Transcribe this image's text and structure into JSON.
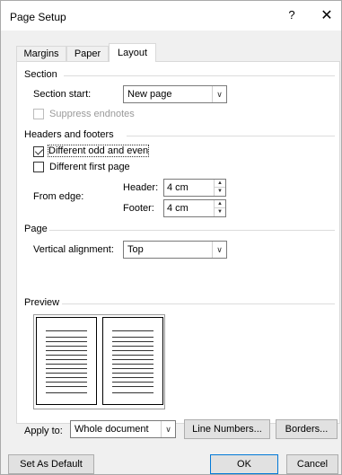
{
  "window": {
    "title": "Page Setup",
    "help_label": "?",
    "close_label": "✕"
  },
  "tabs": [
    {
      "label": "Margins"
    },
    {
      "label": "Paper"
    },
    {
      "label": "Layout",
      "active": true
    }
  ],
  "section": {
    "title": "Section",
    "start_label": "Section start:",
    "start_value": "New page",
    "suppress_label": "Suppress endnotes"
  },
  "headers_footers": {
    "title": "Headers and footers",
    "odd_even_label": "Different odd and even",
    "odd_even_checked": true,
    "first_page_label": "Different first page",
    "first_page_checked": false,
    "from_edge_label": "From edge:",
    "header_label": "Header:",
    "header_value": "4 cm",
    "footer_label": "Footer:",
    "footer_value": "4 cm"
  },
  "page": {
    "title": "Page",
    "valign_label": "Vertical alignment:",
    "valign_value": "Top"
  },
  "preview": {
    "title": "Preview"
  },
  "apply": {
    "label": "Apply to:",
    "value": "Whole document",
    "line_numbers_label": "Line Numbers...",
    "borders_label": "Borders..."
  },
  "footer_buttons": {
    "set_default_label": "Set As Default",
    "ok_label": "OK",
    "cancel_label": "Cancel"
  },
  "colors": {
    "focus_border": "#0078d7",
    "dialog_bg": "#f0f0f0"
  }
}
